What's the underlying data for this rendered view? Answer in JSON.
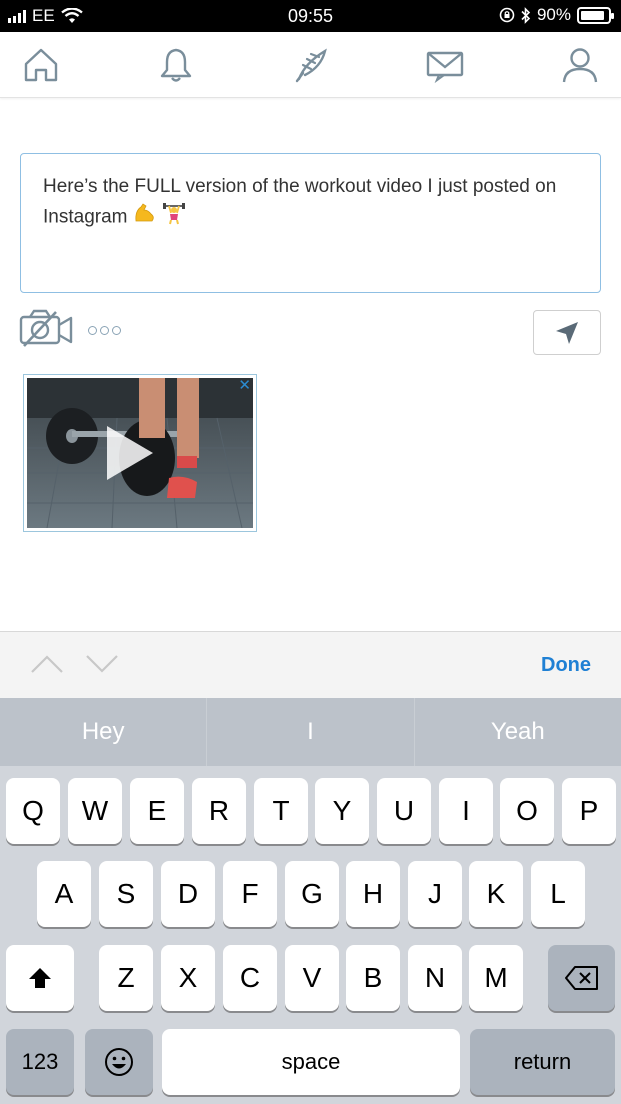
{
  "status_bar": {
    "carrier": "EE",
    "time": "09:55",
    "battery_percent": "90%",
    "battery_level": 0.9
  },
  "nav": {
    "items": [
      "home-icon",
      "bell-icon",
      "feather-icon",
      "envelope-icon",
      "user-icon"
    ]
  },
  "compose": {
    "text": "Here’s the FULL version of the workout video I just posted on Instagram",
    "emojis": [
      "flexed-biceps-emoji",
      "weightlifter-emoji"
    ]
  },
  "toolbar": {
    "camera_icon": "camera-off-icon",
    "more_icon": "more-dots-icon",
    "send_icon": "send-arrow-icon"
  },
  "media": {
    "remove_label": "✕",
    "play_icon": "play-icon"
  },
  "accessory": {
    "done_label": "Done"
  },
  "suggestions": [
    "Hey",
    "I",
    "Yeah"
  ],
  "keyboard": {
    "row1": [
      "Q",
      "W",
      "E",
      "R",
      "T",
      "Y",
      "U",
      "I",
      "O",
      "P"
    ],
    "row2": [
      "A",
      "S",
      "D",
      "F",
      "G",
      "H",
      "J",
      "K",
      "L"
    ],
    "row3": [
      "Z",
      "X",
      "C",
      "V",
      "B",
      "N",
      "M"
    ],
    "numbers_label": "123",
    "space_label": "space",
    "return_label": "return"
  },
  "colors": {
    "accent": "#1f80d4",
    "border": "#8fbfe3",
    "keyboard_bg": "#d1d5db",
    "suggestion_bg": "#bcc2ca"
  }
}
